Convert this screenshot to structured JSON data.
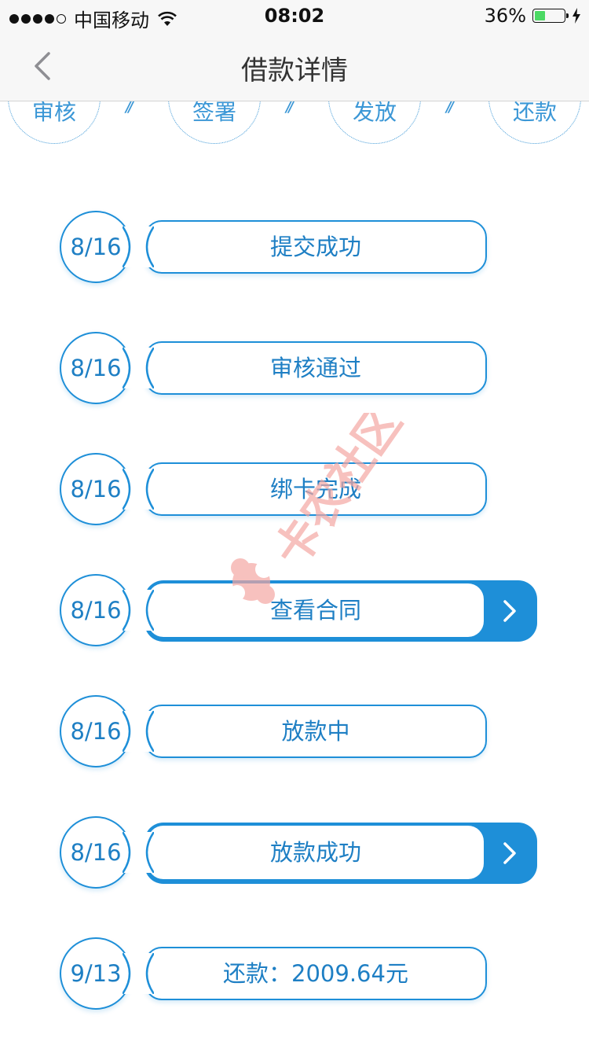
{
  "status_bar": {
    "carrier": "中国移动",
    "time": "08:02",
    "battery_percent": "36%",
    "battery_level": 0.36,
    "signal_dots_filled": 4,
    "signal_dots_total": 5
  },
  "nav": {
    "title": "借款详情",
    "back_icon": "chevron-left-icon"
  },
  "stages": [
    {
      "label": "审核"
    },
    {
      "label": "签署"
    },
    {
      "label": "发放"
    },
    {
      "label": "还款"
    }
  ],
  "steps": [
    {
      "date": "8/16",
      "label": "提交成功",
      "active": false
    },
    {
      "date": "8/16",
      "label": "审核通过",
      "active": false
    },
    {
      "date": "8/16",
      "label": "绑卡完成",
      "active": false
    },
    {
      "date": "8/16",
      "label": "查看合同",
      "active": true
    },
    {
      "date": "8/16",
      "label": "放款中",
      "active": false
    },
    {
      "date": "8/16",
      "label": "放款成功",
      "active": true
    },
    {
      "date": "9/13",
      "label": "还款：2009.64元",
      "active": false
    }
  ],
  "watermark": {
    "text": "卡农社区"
  },
  "colors": {
    "accent": "#1e8fd8",
    "text_accent": "#1e7fc4",
    "nav_bg": "#f7f7f7",
    "watermark": "#f4a7a3"
  }
}
